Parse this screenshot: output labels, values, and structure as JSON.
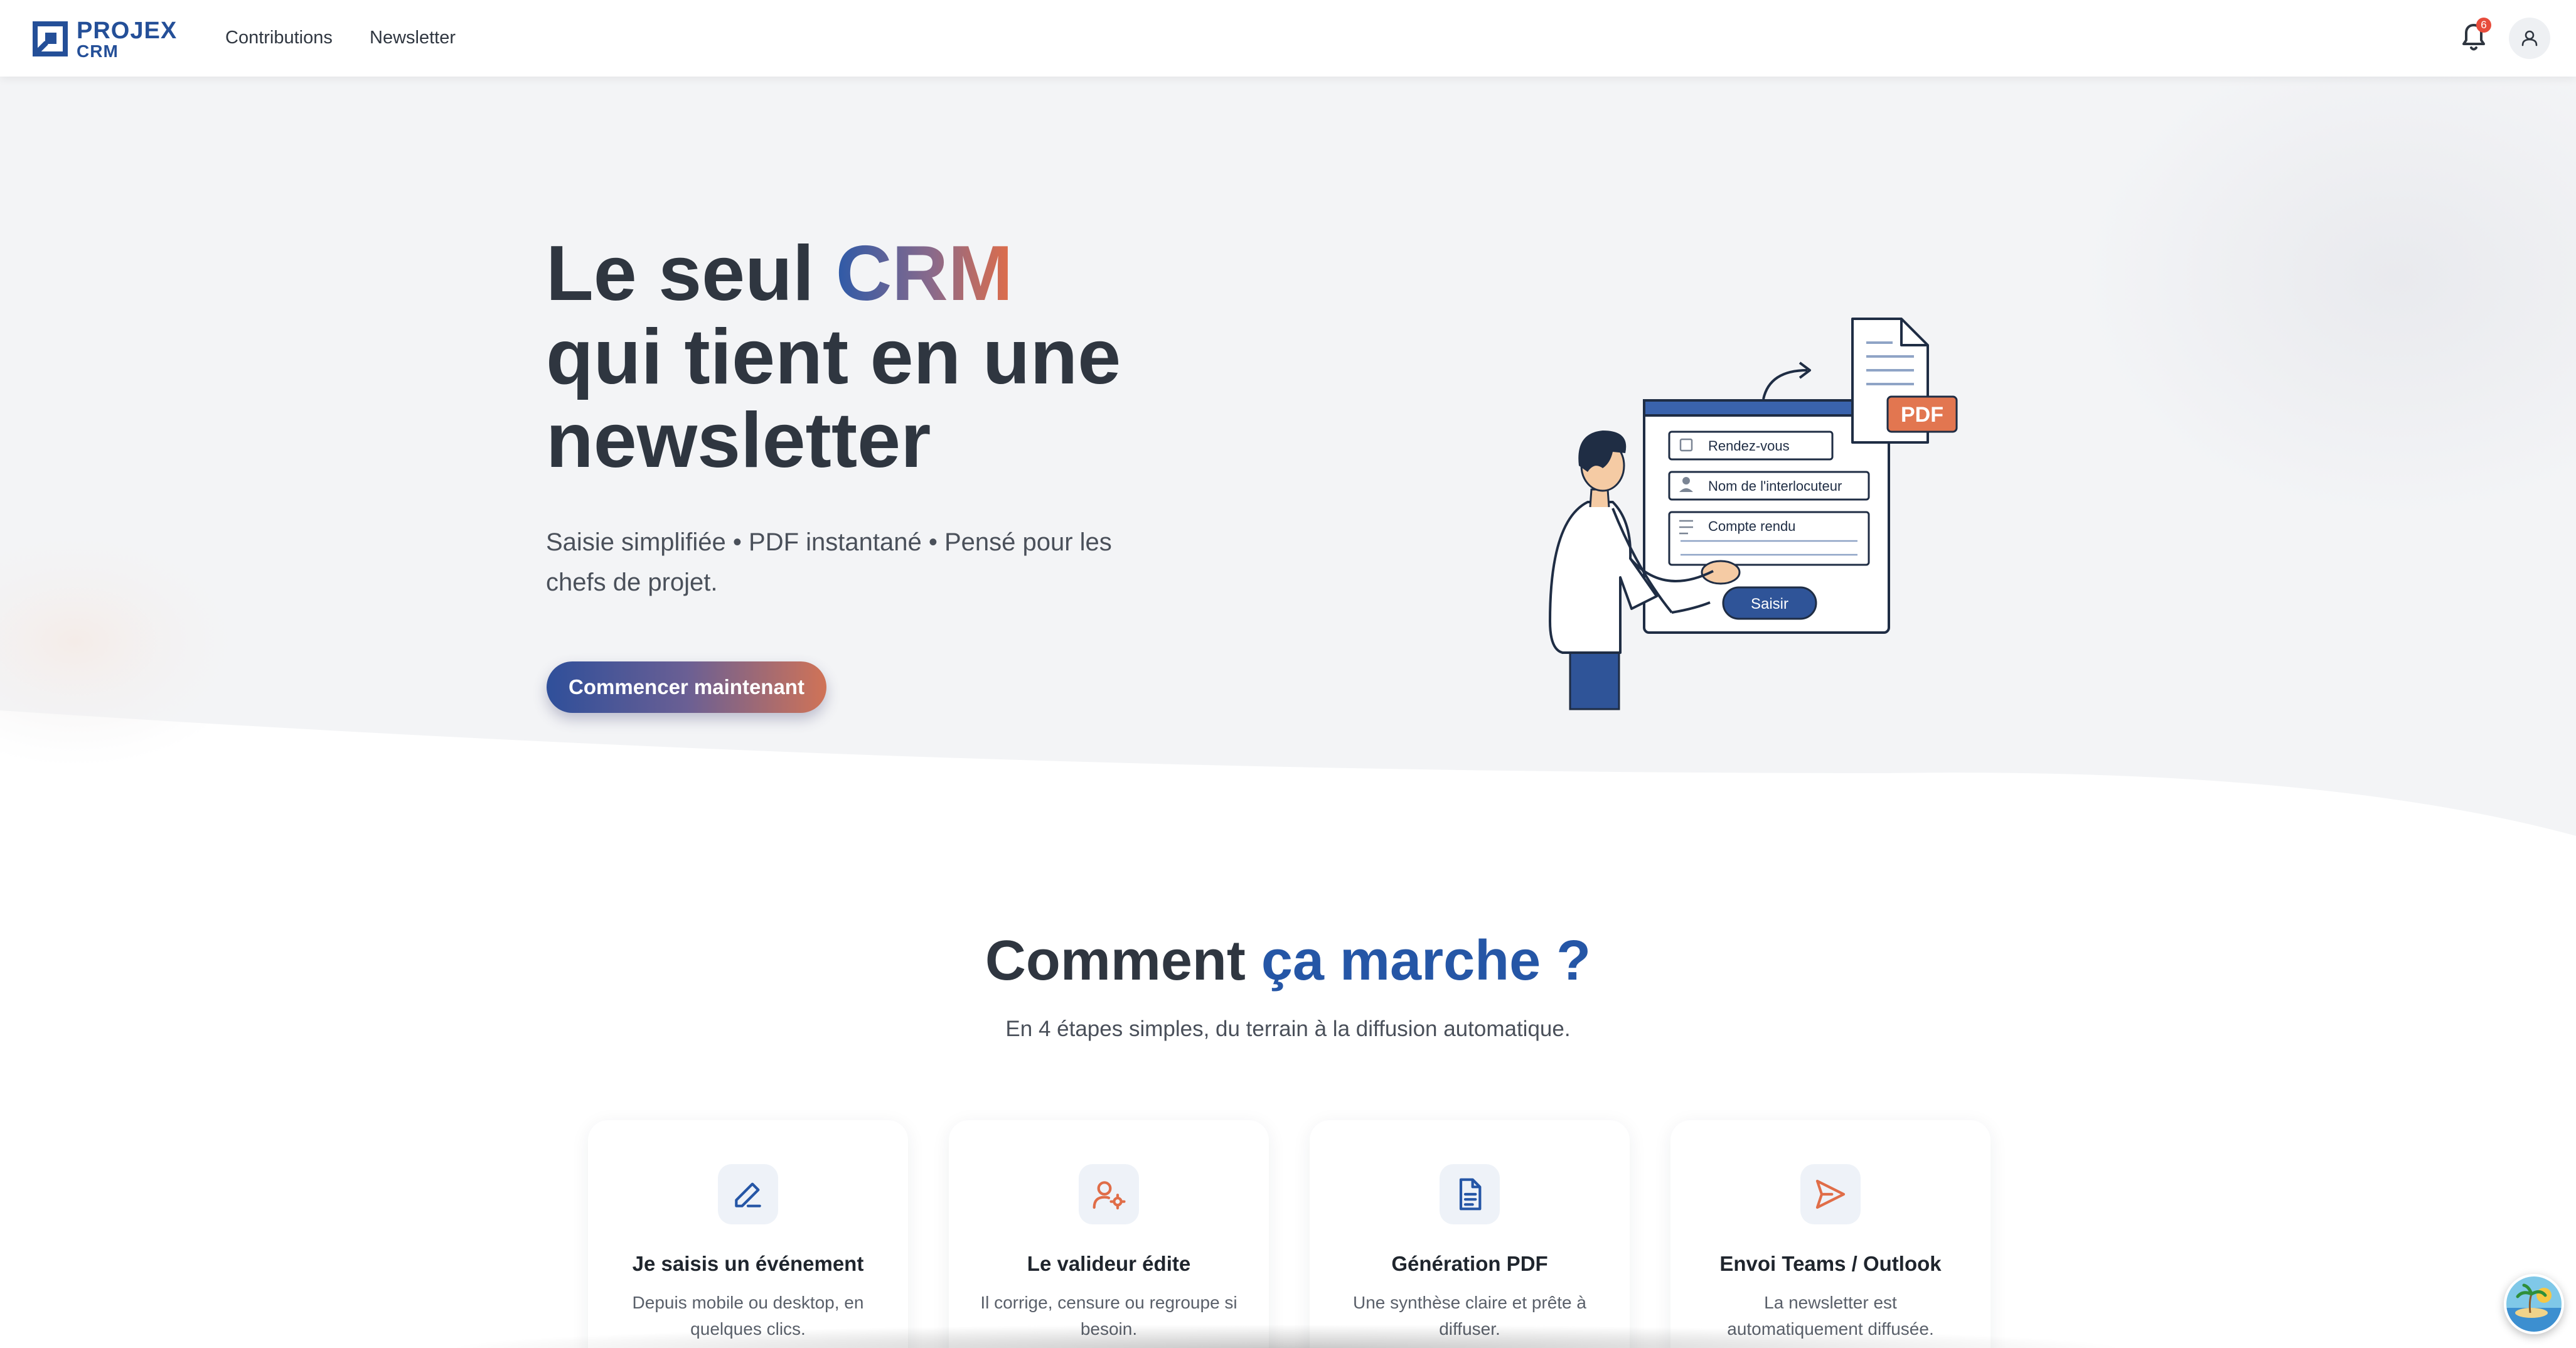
{
  "header": {
    "logo": {
      "line1": "PROJEX",
      "line2": "CRM"
    },
    "nav": [
      {
        "label": "Contributions"
      },
      {
        "label": "Newsletter"
      }
    ],
    "notifications": {
      "count": "6",
      "icon": "bell-icon"
    },
    "user_icon": "user-icon"
  },
  "hero": {
    "title": {
      "part1": "Le seul ",
      "highlight": "CRM",
      "line2": "qui tient en une",
      "line3": "newsletter"
    },
    "subtitle": "Saisie simplifiée • PDF instantané • Pensé pour les chefs de projet.",
    "cta_label": "Commencer maintenant",
    "illustration": {
      "fields": [
        "Rendez-vous",
        "Nom de l'interlocuteur",
        "Compte rendu"
      ],
      "submit_label": "Saisir",
      "pdf_label": "PDF"
    }
  },
  "how": {
    "title": {
      "part1": "Comment ",
      "highlight": "ça marche ?"
    },
    "subtitle": "En 4 étapes simples, du terrain à la diffusion automatique.",
    "steps": [
      {
        "icon": "pencil-icon",
        "title": "Je saisis un événement",
        "text": "Depuis mobile ou desktop, en quelques clics."
      },
      {
        "icon": "user-gear-icon",
        "title": "Le valideur édite",
        "text": "Il corrige, censure ou regroupe si besoin."
      },
      {
        "icon": "document-icon",
        "title": "Génération PDF",
        "text": "Une synthèse claire et prête à diffuser."
      },
      {
        "icon": "send-icon",
        "title": "Envoi Teams / Outlook",
        "text": "La newsletter est automatiquement diffusée."
      }
    ]
  },
  "colors": {
    "brand": "#244f98",
    "accent": "#e06d48",
    "badge": "#e74c3c",
    "text": "#2f3640"
  }
}
